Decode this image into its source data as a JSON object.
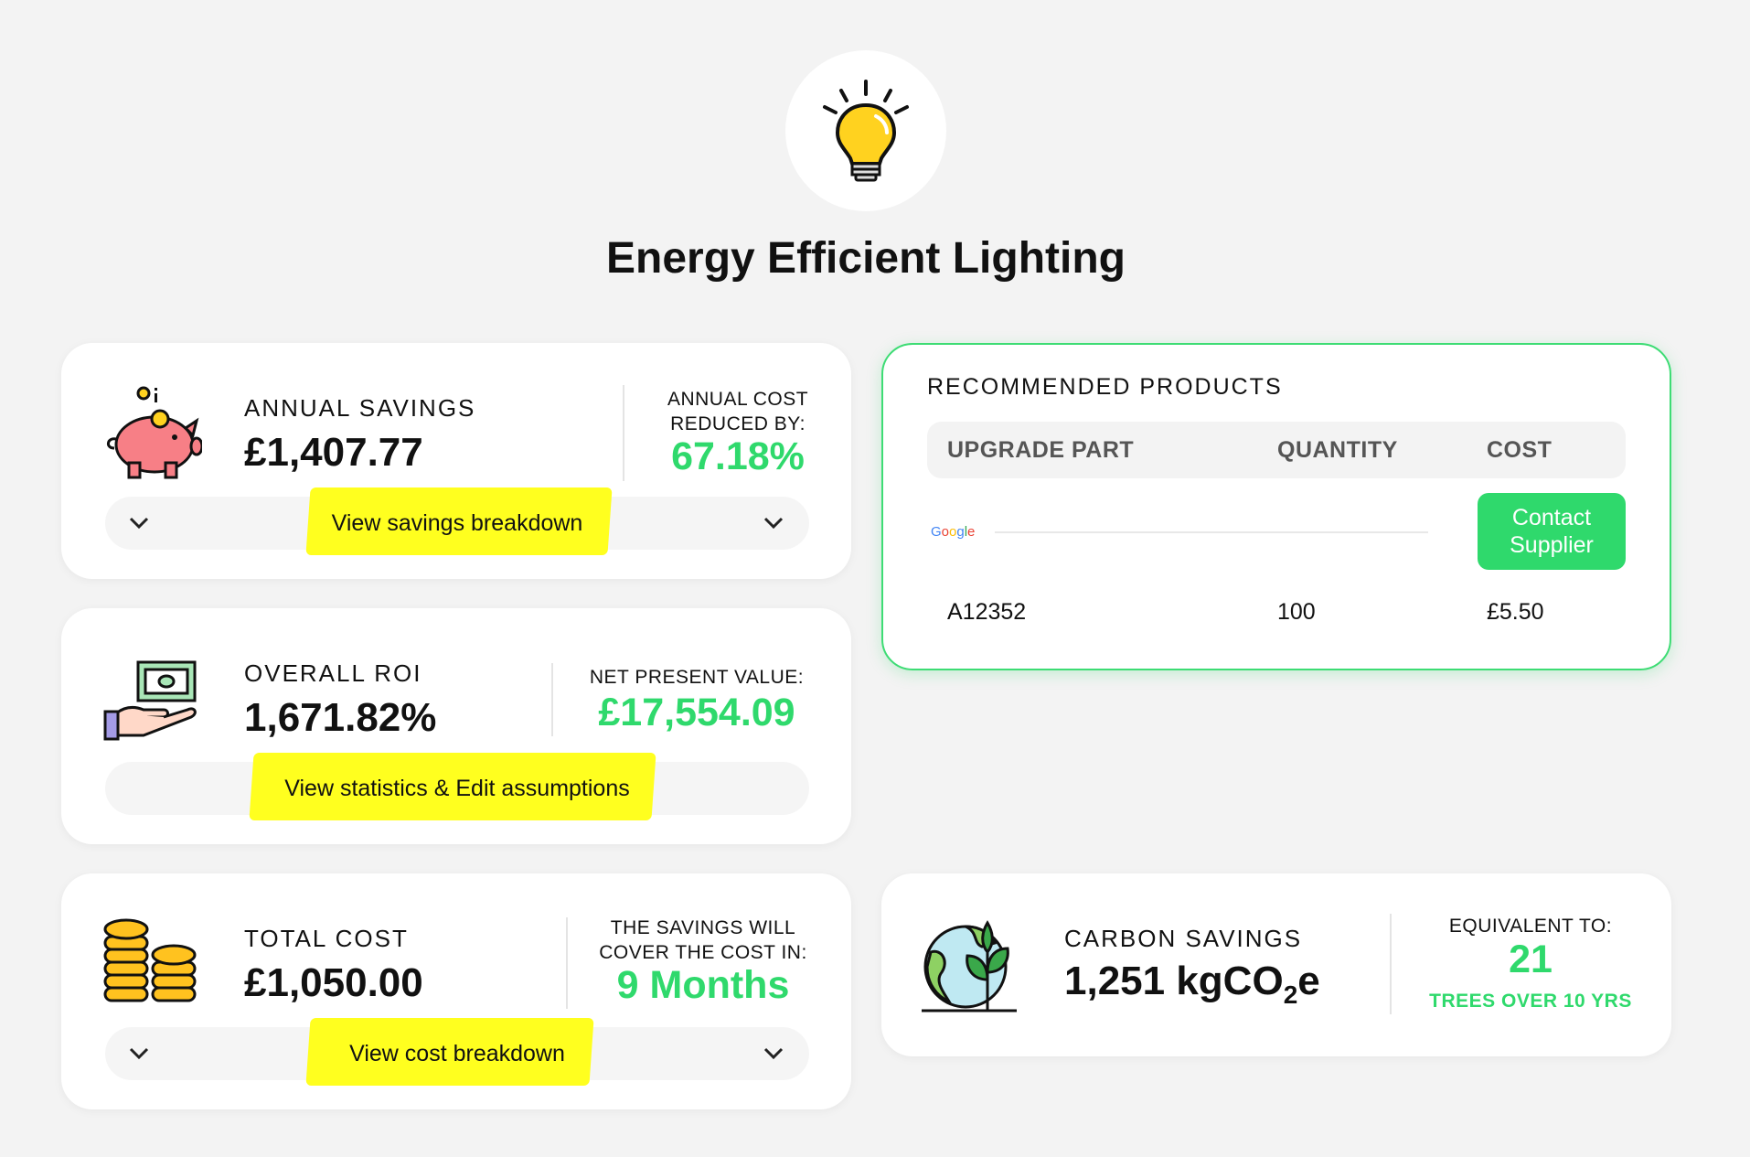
{
  "page": {
    "title": "Energy Efficient Lighting",
    "hero_icon": "lightbulb-icon"
  },
  "savings": {
    "icon": "piggy-bank-icon",
    "label": "ANNUAL SAVINGS",
    "value": "£1,407.77",
    "side_label_line1": "ANNUAL COST",
    "side_label_line2": "REDUCED BY:",
    "side_value": "67.18%",
    "link": "View savings breakdown"
  },
  "roi": {
    "icon": "money-hand-icon",
    "label": "OVERALL ROI",
    "value": "1,671.82%",
    "side_label": "NET PRESENT VALUE:",
    "side_value": "£17,554.09",
    "link": "View statistics & Edit assumptions"
  },
  "cost": {
    "icon": "coins-stack-icon",
    "label": "TOTAL COST",
    "value": "£1,050.00",
    "side_label_line1": "THE SAVINGS WILL",
    "side_label_line2": "COVER THE COST IN:",
    "side_value": "9 Months",
    "link": "View cost breakdown"
  },
  "products": {
    "title": "RECOMMENDED PRODUCTS",
    "columns": [
      "UPGRADE PART",
      "QUANTITY",
      "COST"
    ],
    "supplier_logo": "Google",
    "contact_button": "Contact Supplier",
    "rows": [
      {
        "part": "A12352",
        "quantity": "100",
        "cost": "£5.50"
      }
    ]
  },
  "carbon": {
    "icon": "globe-plant-icon",
    "label": "CARBON SAVINGS",
    "value_prefix": "1,251 kgCO",
    "value_sub": "2",
    "value_suffix": "e",
    "side_label": "EQUIVALENT TO:",
    "side_value": "21",
    "side_sub": "TREES OVER 10 YRS"
  },
  "colors": {
    "accent_green": "#2fd96c",
    "highlight_yellow": "#ffff1f"
  }
}
